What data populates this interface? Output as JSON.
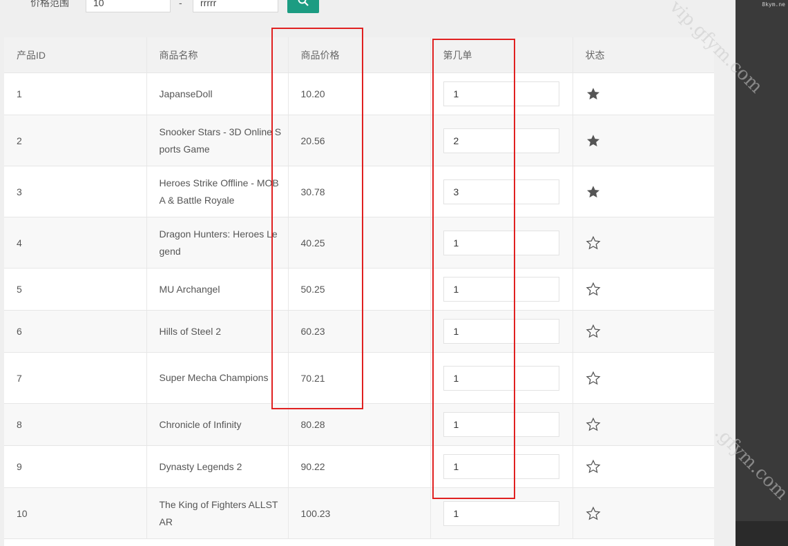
{
  "filter": {
    "label": "价格范围",
    "min_value": "10",
    "separator": "-",
    "max_value": "rrrrr"
  },
  "table": {
    "headers": {
      "id": "产品ID",
      "name": "商品名称",
      "price": "商品价格",
      "order": "第几单",
      "status": "状态"
    },
    "rows": [
      {
        "id": "1",
        "name": "JapanseDoll",
        "price": "10.20",
        "order": "1",
        "starred": true
      },
      {
        "id": "2",
        "name": "Snooker Stars - 3D Online Sports Game",
        "price": "20.56",
        "order": "2",
        "starred": true
      },
      {
        "id": "3",
        "name": "Heroes Strike Offline - MOBA & Battle Royale",
        "price": "30.78",
        "order": "3",
        "starred": true
      },
      {
        "id": "4",
        "name": "Dragon Hunters: Heroes Legend",
        "price": "40.25",
        "order": "1",
        "starred": false
      },
      {
        "id": "5",
        "name": "MU Archangel",
        "price": "50.25",
        "order": "1",
        "starred": false
      },
      {
        "id": "6",
        "name": "Hills of Steel 2",
        "price": "60.23",
        "order": "1",
        "starred": false
      },
      {
        "id": "7",
        "name": "Super Mecha Champions",
        "price": "70.21",
        "order": "1",
        "starred": false
      },
      {
        "id": "8",
        "name": "Chronicle of Infinity",
        "price": "80.28",
        "order": "1",
        "starred": false
      },
      {
        "id": "9",
        "name": "Dynasty Legends 2",
        "price": "90.22",
        "order": "1",
        "starred": false
      },
      {
        "id": "10",
        "name": "The King of Fighters ALLSTAR",
        "price": "100.23",
        "order": "1",
        "starred": false
      }
    ]
  },
  "watermark": {
    "corner": "8kym.ne",
    "text_1": "vip.gfym.com",
    "text_2": ".gfym.com"
  },
  "colors": {
    "accent": "#1c9c82",
    "highlight": "#e02020",
    "star": "#555555"
  }
}
